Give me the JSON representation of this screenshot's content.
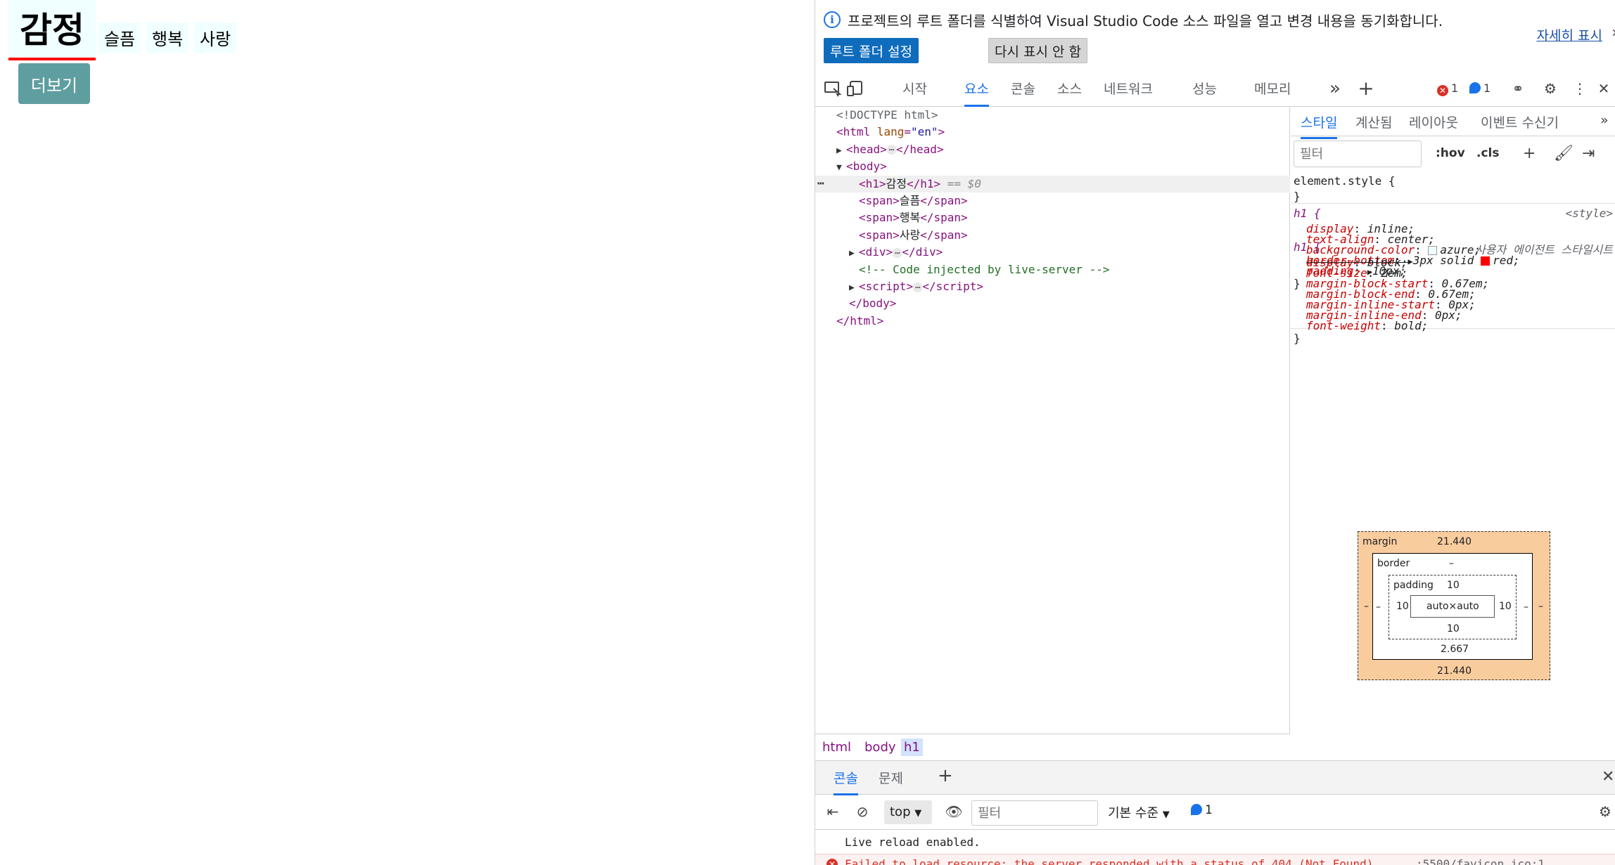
{
  "page": {
    "heading": "감정",
    "spans": [
      "슬픔",
      "행복",
      "사랑"
    ],
    "more_button": "더보기"
  },
  "devtools": {
    "infobar": {
      "message": "프로젝트의 루트 폴더를 식별하여 Visual Studio Code 소스 파일을 열고 변경 내용을 동기화합니다.",
      "learn_more": "자세히 표시",
      "set_root_button": "루트 폴더 설정",
      "dismiss_button": "다시 표시 안 함"
    },
    "tabs": [
      "시작",
      "요소",
      "콘솔",
      "소스",
      "네트워크",
      "성능",
      "메모리"
    ],
    "active_tab": "요소",
    "error_count": "1",
    "message_count": "1",
    "tree": {
      "doctype": "<!DOCTYPE html>",
      "html_open_tag": "html",
      "html_attr": "lang",
      "html_attr_val": "\"en\"",
      "head": "head",
      "body": "body",
      "h1_text": "감정",
      "h1_marker": "== $0",
      "span1": "슬픔",
      "span2": "행복",
      "span3": "사랑",
      "div": "div",
      "comment": "<!-- Code injected by live-server -->",
      "script": "script",
      "body_close": "</body>",
      "html_close": "</html>"
    },
    "breadcrumbs": [
      "html",
      "body",
      "h1"
    ],
    "styles": {
      "tabs": [
        "스타일",
        "계산됨",
        "레이아웃",
        "이벤트 수신기"
      ],
      "filter_placeholder": "필터",
      "hov": ":hov",
      "cls": ".cls",
      "element_style": "element.style {",
      "rule1": {
        "selector": "h1 {",
        "origin": "<style>",
        "props": [
          {
            "name": "display",
            "value": "inline;"
          },
          {
            "name": "text-align",
            "value": "center;"
          },
          {
            "name": "background-color",
            "value": "azure;"
          },
          {
            "name": "border-bottom",
            "value": "3px solid"
          },
          {
            "name": "padding",
            "value": "10px;"
          }
        ],
        "border_color_word": "red;",
        "azure": "#f0ffff",
        "red": "#ff0000"
      },
      "rule2": {
        "selector": "h1 {",
        "origin": "사용자 에이전트 스타일시트",
        "props": [
          {
            "name": "display",
            "value": "block;"
          },
          {
            "name": "font-size",
            "value": "2em;"
          },
          {
            "name": "margin-block-start",
            "value": "0.67em;"
          },
          {
            "name": "margin-block-end",
            "value": "0.67em;"
          },
          {
            "name": "margin-inline-start",
            "value": "0px;"
          },
          {
            "name": "margin-inline-end",
            "value": "0px;"
          },
          {
            "name": "font-weight",
            "value": "bold;"
          }
        ]
      }
    },
    "box_model": {
      "margin_label": "margin",
      "margin_top": "21.440",
      "margin_bottom": "21.440",
      "margin_side": "–",
      "border_label": "border",
      "border_top": "–",
      "border_bottom": "2.667",
      "border_side": "–",
      "padding_label": "padding",
      "padding_top": "10",
      "padding_bottom": "10",
      "padding_left": "10",
      "padding_right": "10",
      "content": "auto×auto"
    },
    "drawer": {
      "tabs": [
        "콘솔",
        "문제"
      ],
      "context": "top",
      "filter_placeholder": "필터",
      "log_level": "기본 수준",
      "message_count": "1",
      "log1": "Live reload enabled.",
      "log2": "Failed to load resource: the server responded with a status of 404 (Not Found)",
      "log2_source": ":5500/favicon.ico:1"
    }
  }
}
